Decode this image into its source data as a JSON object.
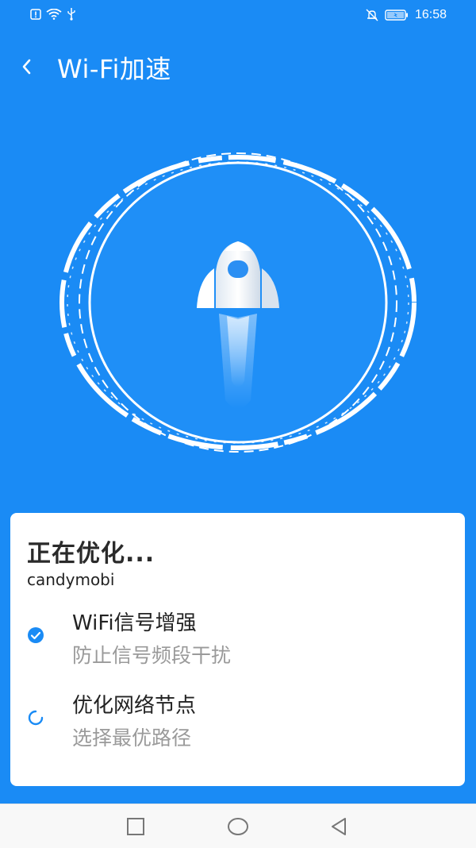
{
  "status_bar": {
    "time": "16:58",
    "left_icons": [
      "alert-icon",
      "wifi-icon",
      "usb-icon"
    ],
    "right_icons": [
      "mute-icon",
      "battery-icon"
    ]
  },
  "header": {
    "title": "Wi-Fi加速",
    "back_icon": "back-arrow-icon"
  },
  "hero": {
    "icon": "rocket-icon",
    "accent": "#1a8bf5",
    "ring_color": "#ffffff"
  },
  "progress_card": {
    "title": "正在优化...",
    "network_name": "candymobi",
    "steps": [
      {
        "title": "WiFi信号增强",
        "description": "防止信号频段干扰",
        "status": "done",
        "icon": "check-circle-icon"
      },
      {
        "title": "优化网络节点",
        "description": "选择最优路径",
        "status": "in-progress",
        "icon": "spinner-icon"
      }
    ]
  },
  "nav_bar": {
    "buttons": [
      "recent-apps-icon",
      "home-icon",
      "back-triangle-icon"
    ]
  }
}
